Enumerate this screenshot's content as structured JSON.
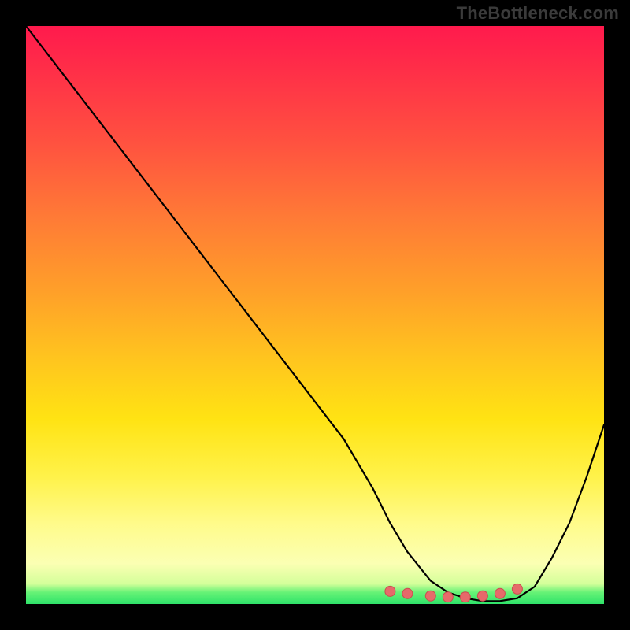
{
  "watermark": "TheBottleneck.com",
  "colors": {
    "background": "#000000",
    "curve": "#000000",
    "marker_fill": "#e66a6a",
    "marker_stroke": "#c94e4e",
    "gradient_top": "#ff1a4d",
    "gradient_bottom": "#2fe36a",
    "watermark": "#3b3b3b"
  },
  "chart_data": {
    "type": "line",
    "title": "",
    "xlabel": "",
    "ylabel": "",
    "xlim": [
      0,
      100
    ],
    "ylim": [
      0,
      100
    ],
    "x": [
      0,
      5,
      10,
      15,
      20,
      25,
      30,
      35,
      40,
      45,
      50,
      55,
      60,
      63,
      66,
      70,
      73,
      76,
      79,
      82,
      85,
      88,
      91,
      94,
      97,
      100
    ],
    "values": [
      100,
      93.5,
      87,
      80.5,
      74,
      67.5,
      61,
      54.5,
      48,
      41.5,
      35,
      28.5,
      20,
      14,
      9,
      4,
      2,
      1,
      0.5,
      0.5,
      1,
      3,
      8,
      14,
      22,
      31
    ],
    "markers": {
      "x": [
        63,
        66,
        70,
        73,
        76,
        79,
        82,
        85
      ],
      "values": [
        2.2,
        1.8,
        1.4,
        1.2,
        1.2,
        1.4,
        1.8,
        2.6
      ]
    },
    "notes": "Curve is bottleneck-percentage style: descends roughly linearly from top-left, reaches near-zero trough around x≈76–80, then rises toward lower-right. Marker cluster (salmon dots) sits along trough floor."
  }
}
